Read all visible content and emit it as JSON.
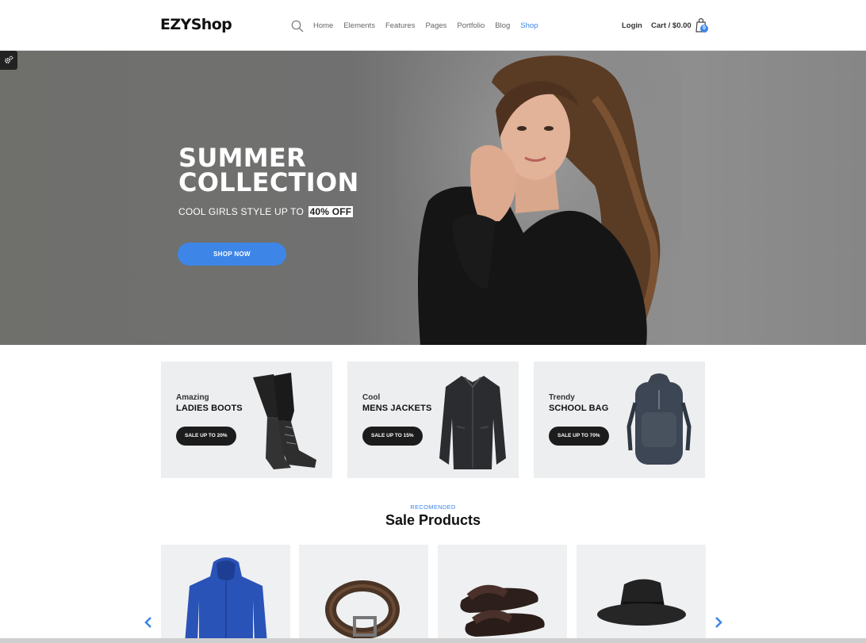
{
  "header": {
    "logo": "EZYShop",
    "nav": [
      "Home",
      "Elements",
      "Features",
      "Pages",
      "Portfolio",
      "Blog",
      "Shop"
    ],
    "active_nav": "Shop",
    "login": "Login",
    "cart": "Cart / $0.00",
    "cart_count": "0"
  },
  "hero": {
    "title_line1": "SUMMER",
    "title_line2": "COLLECTION",
    "subtitle": "COOL GIRLS STYLE UP TO",
    "highlight": "40% OFF",
    "button": "SHOP NOW"
  },
  "banners": [
    {
      "kicker": "Amazing",
      "name": "LADIES BOOTS",
      "pill": "SALE UP TO 20%"
    },
    {
      "kicker": "Cool",
      "name": "MENS JACKETS",
      "pill": "SALE UP TO 15%"
    },
    {
      "kicker": "Trendy",
      "name": "SCHOOL BAG",
      "pill": "SALE UP TO 70%"
    }
  ],
  "sale": {
    "kicker": "RECOMENDED",
    "title": "Sale Products"
  },
  "products": [
    {
      "icon": "hoodie-icon"
    },
    {
      "icon": "belt-icon"
    },
    {
      "icon": "sandals-icon"
    },
    {
      "icon": "hat-icon"
    }
  ],
  "colors": {
    "accent": "#3d86e8",
    "dark": "#1c1c1c",
    "banner_bg": "#eceeef"
  }
}
